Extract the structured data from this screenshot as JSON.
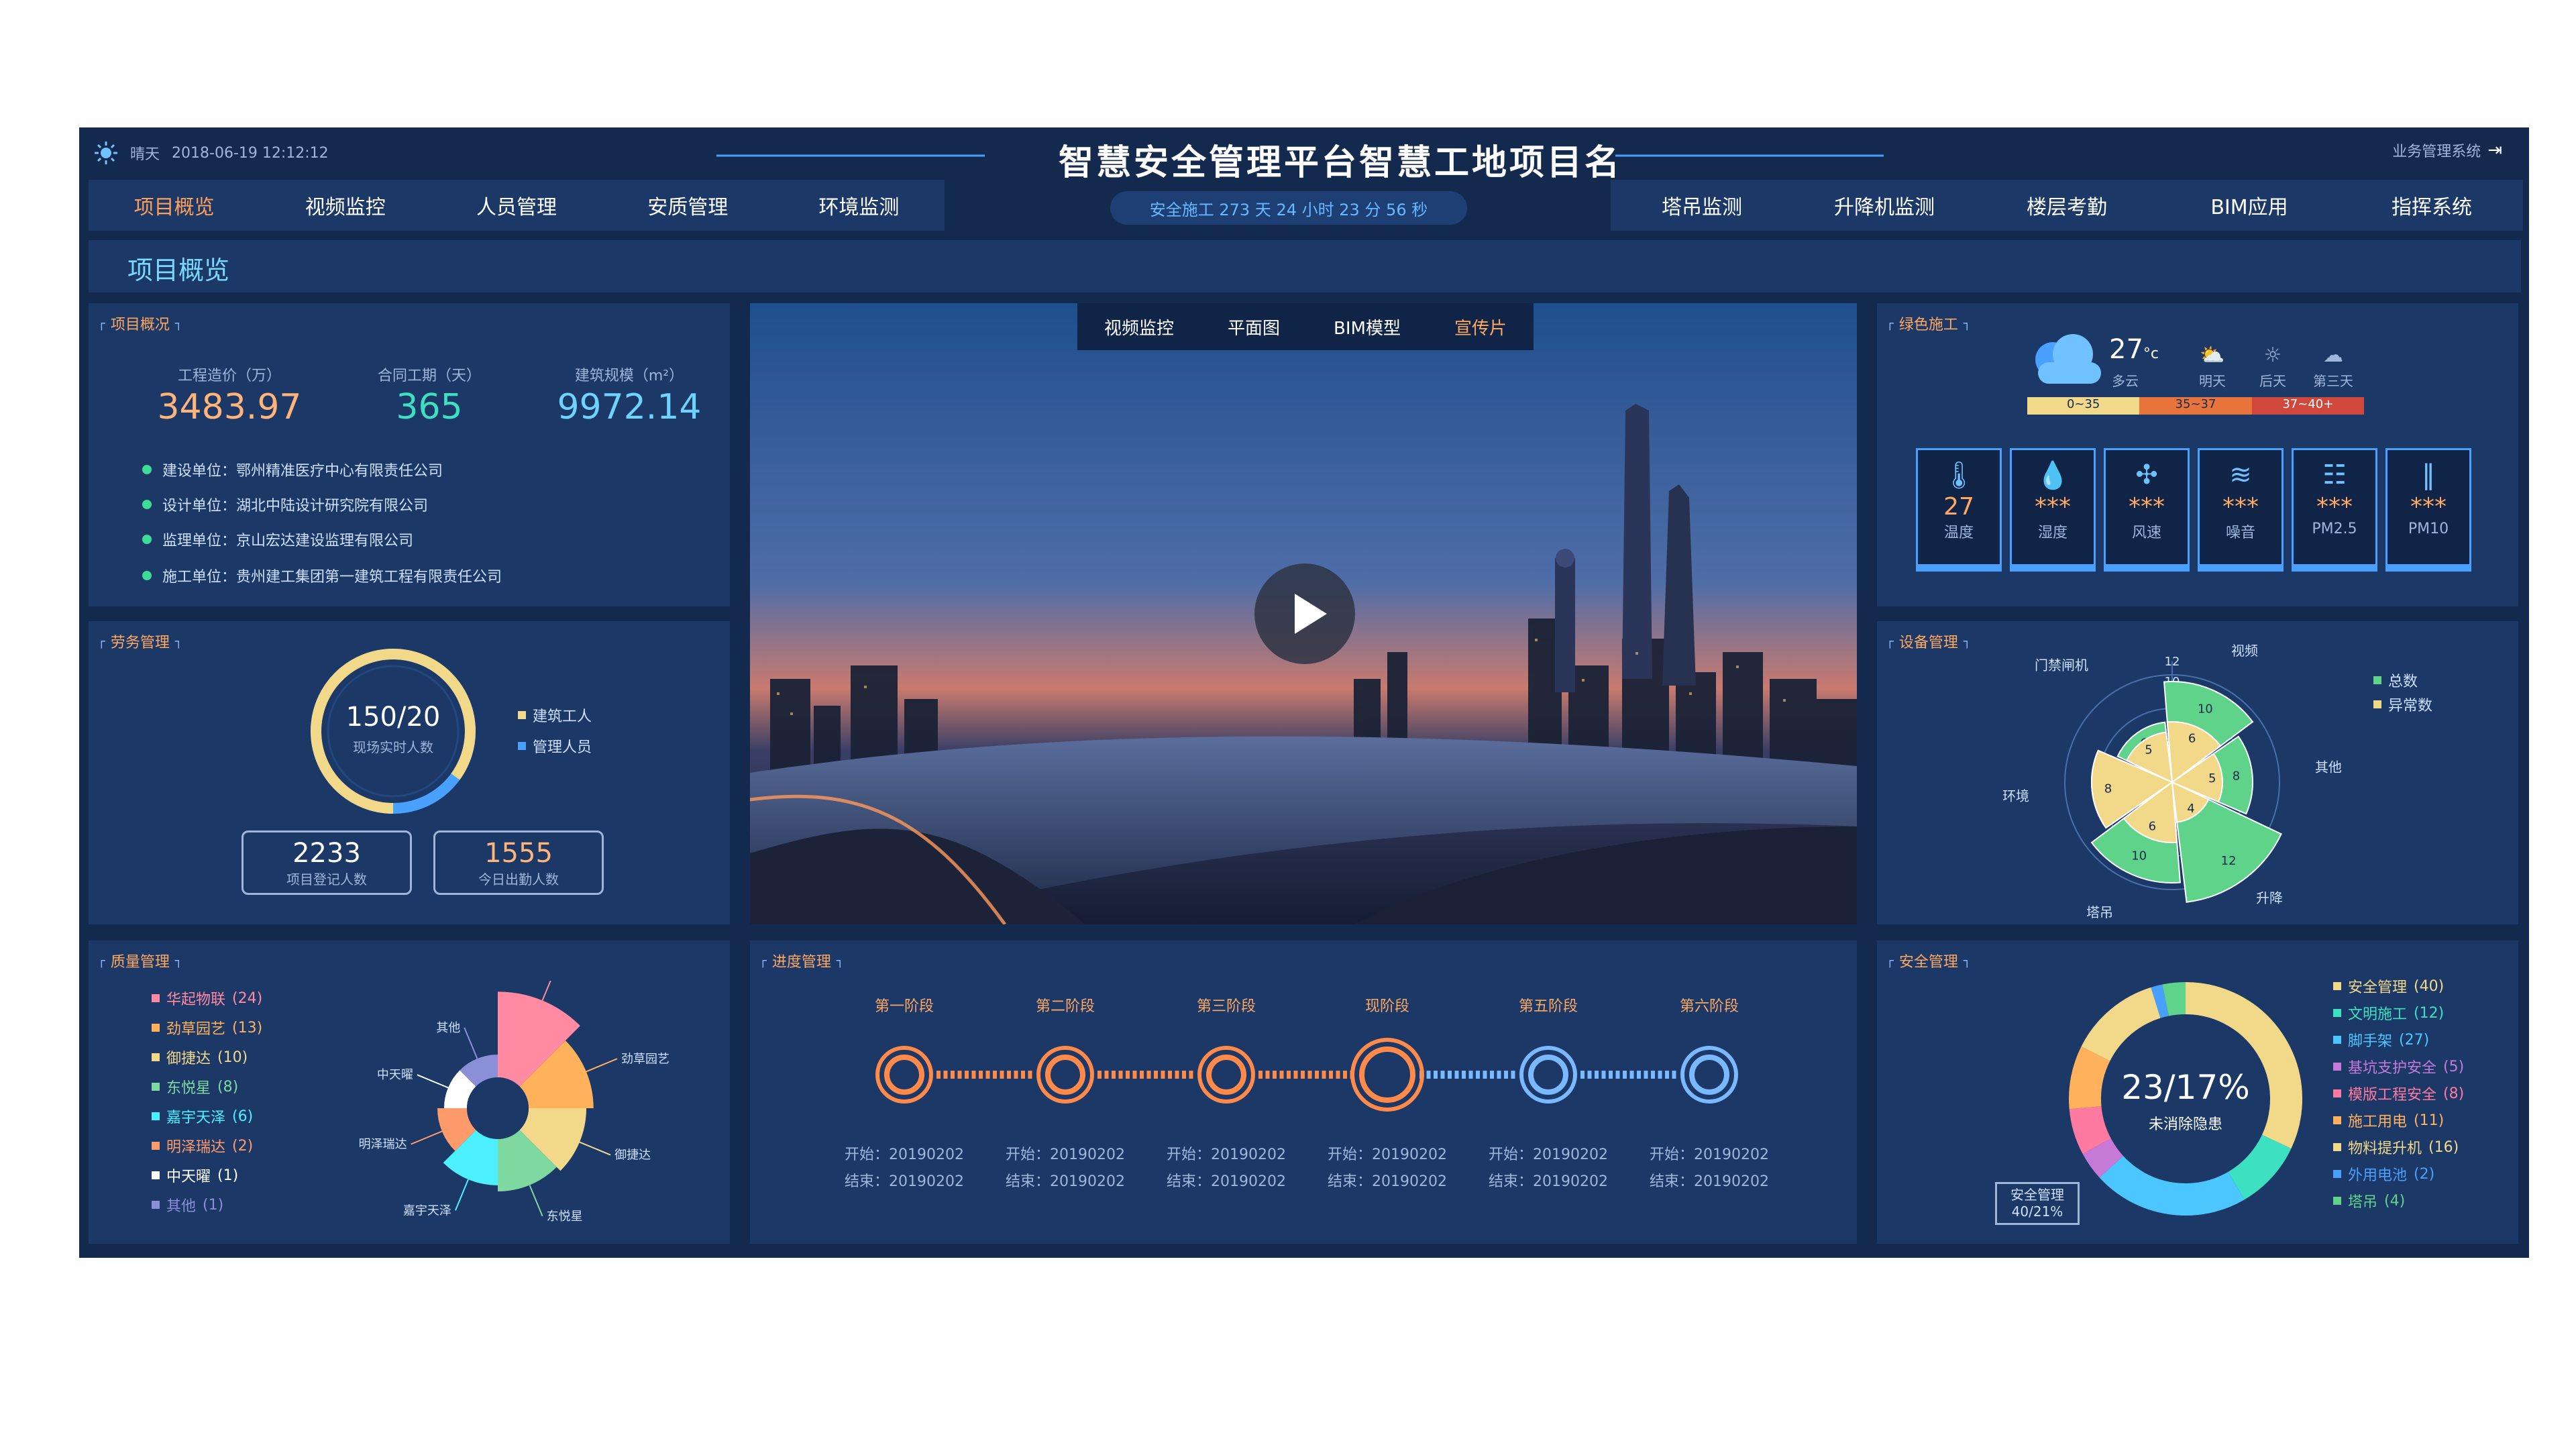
{
  "header": {
    "weather_text": "晴天",
    "datetime": "2018-06-19 12:12:12",
    "title": "智慧安全管理平台智慧工地项目名",
    "countdown": "安全施工 273 天 24 小时 23 分 56 秒",
    "biz_system": "业务管理系统"
  },
  "nav_left": [
    "项目概览",
    "视频监控",
    "人员管理",
    "安质管理",
    "环境监测"
  ],
  "nav_right": [
    "塔吊监测",
    "升降机监测",
    "楼层考勤",
    "BIM应用",
    "指挥系统"
  ],
  "section_title": "项目概览",
  "project": {
    "tag": "项目概况",
    "stats": [
      {
        "label": "工程造价（万）",
        "value": "3483.97",
        "color": "#ffb47a"
      },
      {
        "label": "合同工期（天）",
        "value": "365",
        "color": "#3de0c0"
      },
      {
        "label": "建筑规模（m²）",
        "value": "9972.14",
        "color": "#6fd3ff"
      }
    ],
    "info": [
      "建设单位：鄂州精准医疗中心有限责任公司",
      "设计单位：湖北中陆设计研究院有限公司",
      "监理单位：京山宏达建设监理有限公司",
      "施工单位：贵州建工集团第一建筑工程有限责任公司"
    ]
  },
  "labor": {
    "tag": "劳务管理",
    "ratio": "150/20",
    "ratio_label": "现场实时人数",
    "workers_fraction": 0.85,
    "legend": [
      {
        "name": "建筑工人",
        "color": "#f2d98a"
      },
      {
        "name": "管理人员",
        "color": "#4aa0ff"
      }
    ],
    "boxes": [
      {
        "value": "2233",
        "label": "项目登记人数",
        "color": "#ffffff"
      },
      {
        "value": "1555",
        "label": "今日出勤人数",
        "color": "#ffb47a"
      }
    ]
  },
  "video": {
    "tabs": [
      "视频监控",
      "平面图",
      "BIM模型",
      "宣传片"
    ],
    "active_tab": 3
  },
  "green": {
    "tag": "绿色施工",
    "temp": "27",
    "temp_unit": "°c",
    "condition": "多云",
    "forecast": [
      "明天",
      "后天",
      "第三天"
    ],
    "scale": [
      {
        "label": "0~35",
        "color": "#f2d98a"
      },
      {
        "label": "35~37",
        "color": "#e8743b"
      },
      {
        "label": "37~40+",
        "color": "#d0473b"
      }
    ],
    "cards": [
      {
        "icon": "thermometer-icon",
        "glyph": "🌡",
        "value": "27",
        "label": "温度"
      },
      {
        "icon": "droplet-icon",
        "glyph": "💧",
        "value": "***",
        "label": "湿度"
      },
      {
        "icon": "fan-icon",
        "glyph": "✣",
        "value": "***",
        "label": "风速"
      },
      {
        "icon": "noise-icon",
        "glyph": "≋",
        "value": "***",
        "label": "噪音"
      },
      {
        "icon": "pm25-icon",
        "glyph": "☷",
        "value": "***",
        "label": "PM2.5"
      },
      {
        "icon": "pm10-icon",
        "glyph": "‖",
        "value": "***",
        "label": "PM10"
      }
    ]
  },
  "equipment": {
    "tag": "设备管理",
    "axis_ticks": [
      "12",
      "10",
      "8"
    ],
    "categories": [
      "视频",
      "其他",
      "升降",
      "塔吊",
      "环境",
      "门禁闸机"
    ],
    "legend": [
      {
        "name": "总数",
        "color": "#5fd38a"
      },
      {
        "name": "异常数",
        "color": "#f2d98a"
      }
    ],
    "chart_data": {
      "type": "polar-bar",
      "series": [
        {
          "name": "总数",
          "values": [
            10,
            8,
            12,
            10,
            8,
            6
          ]
        },
        {
          "name": "异常数",
          "values": [
            6,
            5,
            4,
            6,
            8,
            5
          ]
        }
      ]
    }
  },
  "quality": {
    "tag": "质量管理",
    "items": [
      {
        "name": "华起物联",
        "count": "(24)",
        "value": 24,
        "color": "#ff8aa2"
      },
      {
        "name": "劲草园艺",
        "count": "(13)",
        "value": 13,
        "color": "#ffb15c"
      },
      {
        "name": "御捷达",
        "count": "(10)",
        "value": 10,
        "color": "#f2d98a"
      },
      {
        "name": "东悦星",
        "count": "(8)",
        "value": 8,
        "color": "#7ed9a0"
      },
      {
        "name": "嘉宇天泽",
        "count": "(6)",
        "value": 6,
        "color": "#4cf0ff"
      },
      {
        "name": "明泽瑞达",
        "count": "(2)",
        "value": 2,
        "color": "#ff9a6a"
      },
      {
        "name": "中天曜",
        "count": "(1)",
        "value": 1,
        "color": "#ffffff"
      },
      {
        "name": "其他",
        "count": "(1)",
        "value": 1,
        "color": "#8b8fd8"
      }
    ]
  },
  "progress": {
    "tag": "进度管理",
    "current_index": 3,
    "phases": [
      {
        "name": "第一阶段",
        "start": "开始：20190202",
        "end": "结束：20190202"
      },
      {
        "name": "第二阶段",
        "start": "开始：20190202",
        "end": "结束：20190202"
      },
      {
        "name": "第三阶段",
        "start": "开始：20190202",
        "end": "结束：20190202"
      },
      {
        "name": "现阶段",
        "start": "开始：20190202",
        "end": "结束：20190202"
      },
      {
        "name": "第五阶段",
        "start": "开始：20190202",
        "end": "结束：20190202"
      },
      {
        "name": "第六阶段",
        "start": "开始：20190202",
        "end": "结束：20190202"
      }
    ]
  },
  "safety": {
    "tag": "安全管理",
    "center_value": "23/17%",
    "center_label": "未消除隐患",
    "callout_title": "安全管理",
    "callout_value": "40/21%",
    "items": [
      {
        "name": "安全管理",
        "count": "(40)",
        "value": 40,
        "color": "#f2d98a"
      },
      {
        "name": "文明施工",
        "count": "(12)",
        "value": 12,
        "color": "#3de0c0"
      },
      {
        "name": "脚手架",
        "count": "(27)",
        "value": 27,
        "color": "#4cc6ff"
      },
      {
        "name": "基坑支护安全",
        "count": "(5)",
        "value": 5,
        "color": "#c57ad8"
      },
      {
        "name": "模版工程安全",
        "count": "(8)",
        "value": 8,
        "color": "#ff7aa0"
      },
      {
        "name": "施工用电",
        "count": "(11)",
        "value": 11,
        "color": "#ffb15c"
      },
      {
        "name": "物料提升机",
        "count": "(16)",
        "value": 16,
        "color": "#f2d98a"
      },
      {
        "name": "外用电池",
        "count": "(2)",
        "value": 2,
        "color": "#4aa0ff"
      },
      {
        "name": "塔吊",
        "count": "(4)",
        "value": 4,
        "color": "#5fd38a"
      }
    ]
  }
}
